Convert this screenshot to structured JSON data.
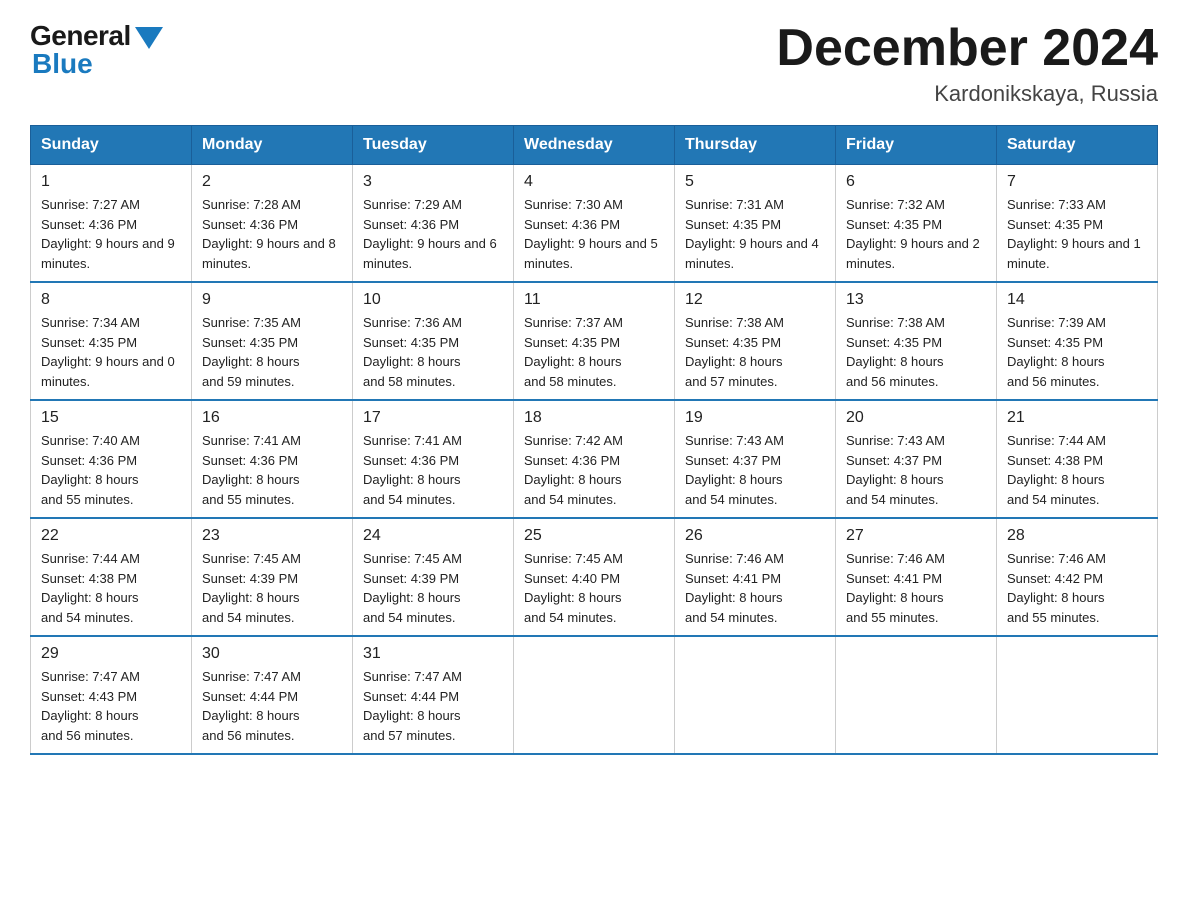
{
  "header": {
    "logo_general": "General",
    "logo_blue": "Blue",
    "month_title": "December 2024",
    "location": "Kardonikskaya, Russia"
  },
  "weekdays": [
    "Sunday",
    "Monday",
    "Tuesday",
    "Wednesday",
    "Thursday",
    "Friday",
    "Saturday"
  ],
  "weeks": [
    [
      {
        "day": "1",
        "sunrise": "7:27 AM",
        "sunset": "4:36 PM",
        "daylight": "9 hours and 9 minutes."
      },
      {
        "day": "2",
        "sunrise": "7:28 AM",
        "sunset": "4:36 PM",
        "daylight": "9 hours and 8 minutes."
      },
      {
        "day": "3",
        "sunrise": "7:29 AM",
        "sunset": "4:36 PM",
        "daylight": "9 hours and 6 minutes."
      },
      {
        "day": "4",
        "sunrise": "7:30 AM",
        "sunset": "4:36 PM",
        "daylight": "9 hours and 5 minutes."
      },
      {
        "day": "5",
        "sunrise": "7:31 AM",
        "sunset": "4:35 PM",
        "daylight": "9 hours and 4 minutes."
      },
      {
        "day": "6",
        "sunrise": "7:32 AM",
        "sunset": "4:35 PM",
        "daylight": "9 hours and 2 minutes."
      },
      {
        "day": "7",
        "sunrise": "7:33 AM",
        "sunset": "4:35 PM",
        "daylight": "9 hours and 1 minute."
      }
    ],
    [
      {
        "day": "8",
        "sunrise": "7:34 AM",
        "sunset": "4:35 PM",
        "daylight": "9 hours and 0 minutes."
      },
      {
        "day": "9",
        "sunrise": "7:35 AM",
        "sunset": "4:35 PM",
        "daylight": "8 hours and 59 minutes."
      },
      {
        "day": "10",
        "sunrise": "7:36 AM",
        "sunset": "4:35 PM",
        "daylight": "8 hours and 58 minutes."
      },
      {
        "day": "11",
        "sunrise": "7:37 AM",
        "sunset": "4:35 PM",
        "daylight": "8 hours and 58 minutes."
      },
      {
        "day": "12",
        "sunrise": "7:38 AM",
        "sunset": "4:35 PM",
        "daylight": "8 hours and 57 minutes."
      },
      {
        "day": "13",
        "sunrise": "7:38 AM",
        "sunset": "4:35 PM",
        "daylight": "8 hours and 56 minutes."
      },
      {
        "day": "14",
        "sunrise": "7:39 AM",
        "sunset": "4:35 PM",
        "daylight": "8 hours and 56 minutes."
      }
    ],
    [
      {
        "day": "15",
        "sunrise": "7:40 AM",
        "sunset": "4:36 PM",
        "daylight": "8 hours and 55 minutes."
      },
      {
        "day": "16",
        "sunrise": "7:41 AM",
        "sunset": "4:36 PM",
        "daylight": "8 hours and 55 minutes."
      },
      {
        "day": "17",
        "sunrise": "7:41 AM",
        "sunset": "4:36 PM",
        "daylight": "8 hours and 54 minutes."
      },
      {
        "day": "18",
        "sunrise": "7:42 AM",
        "sunset": "4:36 PM",
        "daylight": "8 hours and 54 minutes."
      },
      {
        "day": "19",
        "sunrise": "7:43 AM",
        "sunset": "4:37 PM",
        "daylight": "8 hours and 54 minutes."
      },
      {
        "day": "20",
        "sunrise": "7:43 AM",
        "sunset": "4:37 PM",
        "daylight": "8 hours and 54 minutes."
      },
      {
        "day": "21",
        "sunrise": "7:44 AM",
        "sunset": "4:38 PM",
        "daylight": "8 hours and 54 minutes."
      }
    ],
    [
      {
        "day": "22",
        "sunrise": "7:44 AM",
        "sunset": "4:38 PM",
        "daylight": "8 hours and 54 minutes."
      },
      {
        "day": "23",
        "sunrise": "7:45 AM",
        "sunset": "4:39 PM",
        "daylight": "8 hours and 54 minutes."
      },
      {
        "day": "24",
        "sunrise": "7:45 AM",
        "sunset": "4:39 PM",
        "daylight": "8 hours and 54 minutes."
      },
      {
        "day": "25",
        "sunrise": "7:45 AM",
        "sunset": "4:40 PM",
        "daylight": "8 hours and 54 minutes."
      },
      {
        "day": "26",
        "sunrise": "7:46 AM",
        "sunset": "4:41 PM",
        "daylight": "8 hours and 54 minutes."
      },
      {
        "day": "27",
        "sunrise": "7:46 AM",
        "sunset": "4:41 PM",
        "daylight": "8 hours and 55 minutes."
      },
      {
        "day": "28",
        "sunrise": "7:46 AM",
        "sunset": "4:42 PM",
        "daylight": "8 hours and 55 minutes."
      }
    ],
    [
      {
        "day": "29",
        "sunrise": "7:47 AM",
        "sunset": "4:43 PM",
        "daylight": "8 hours and 56 minutes."
      },
      {
        "day": "30",
        "sunrise": "7:47 AM",
        "sunset": "4:44 PM",
        "daylight": "8 hours and 56 minutes."
      },
      {
        "day": "31",
        "sunrise": "7:47 AM",
        "sunset": "4:44 PM",
        "daylight": "8 hours and 57 minutes."
      },
      null,
      null,
      null,
      null
    ]
  ],
  "labels": {
    "sunrise": "Sunrise:",
    "sunset": "Sunset:",
    "daylight": "Daylight:"
  }
}
